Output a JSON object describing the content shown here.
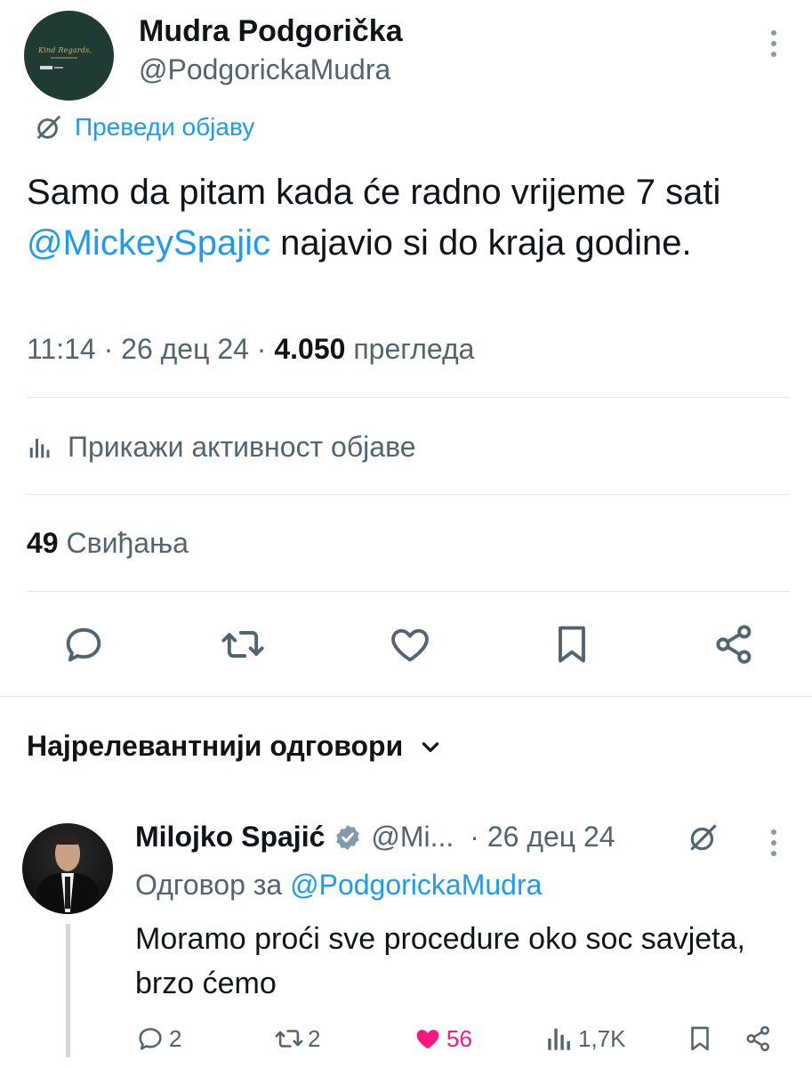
{
  "post": {
    "author_name": "Mudra Podgorička",
    "author_handle": "@PodgorickaMudra",
    "avatar_text": "Kind Regards,",
    "translate_label": "Преведи објаву",
    "text_part1": "Samo da pitam kada će radno vrijeme 7 sati ",
    "mention": "@MickeySpajic",
    "text_part2": " najavio si do kraja godine.",
    "time": "11:14",
    "separator": " · ",
    "date": "26 дец 24",
    "views_count": "4.050",
    "views_label": "прегледа",
    "activity_label": "Прикажи активност објаве",
    "likes_count": "49",
    "likes_label": "Свиђања"
  },
  "replies_header": {
    "label": "Најрелевантнији одговори"
  },
  "reply": {
    "author_name": "Milojko Spajić",
    "author_handle": "@Mi...",
    "date": "· 26 дец 24",
    "reply_to_prefix": "Одговор за ",
    "reply_to_handle": "@PodgorickaMudra",
    "text": "Moramo proći sve procedure oko soc savjeta, brzo ćemo",
    "comments": "2",
    "reposts": "2",
    "likes": "56",
    "views": "1,7K"
  },
  "colors": {
    "link": "#1d9bf0",
    "muted": "#536471",
    "like_active": "#f91880",
    "verified": "#829aab"
  },
  "icons": [
    "more-icon",
    "grok-icon",
    "activity-icon",
    "reply-icon",
    "repost-icon",
    "like-icon",
    "bookmark-icon",
    "share-icon",
    "chevron-down-icon",
    "verified-icon",
    "views-icon"
  ]
}
